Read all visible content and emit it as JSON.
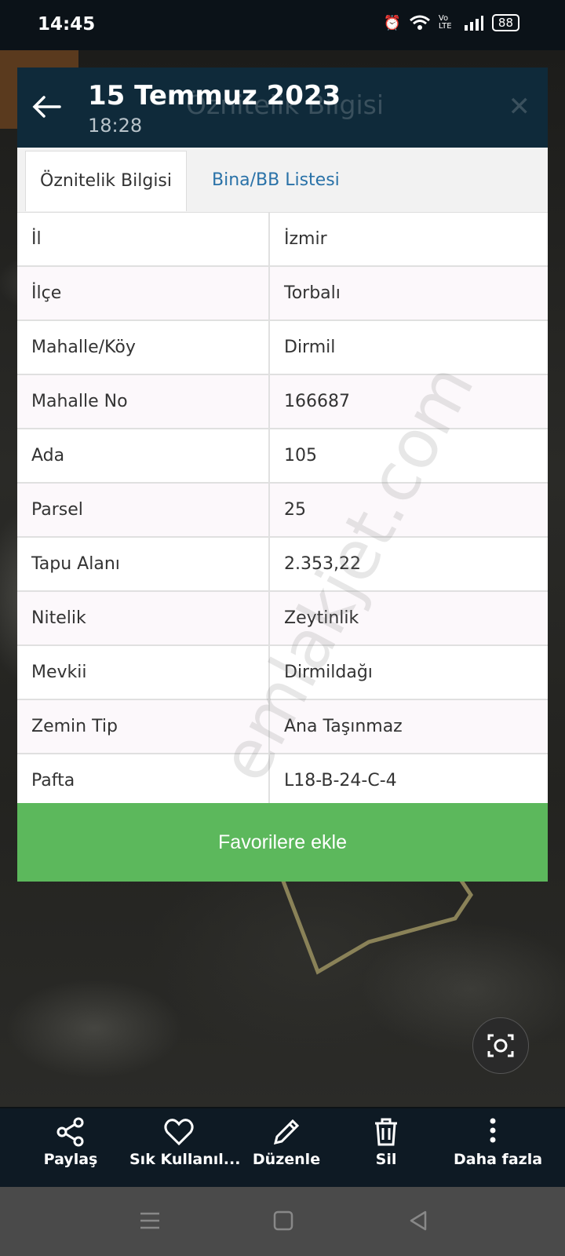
{
  "status_bar": {
    "time": "14:45",
    "network": "Vo LTE",
    "battery": "88"
  },
  "header": {
    "title": "15 Temmuz 2023",
    "subtitle": "18:28",
    "ghost_title": "Öznitelik Bilgisi",
    "ghost_close": "✕"
  },
  "tabs": [
    {
      "label": "Öznitelik Bilgisi",
      "active": true
    },
    {
      "label": "Bina/BB Listesi",
      "active": false
    }
  ],
  "attributes": [
    {
      "key": "İl",
      "value": "İzmir"
    },
    {
      "key": "İlçe",
      "value": "Torbalı"
    },
    {
      "key": "Mahalle/Köy",
      "value": "Dirmil"
    },
    {
      "key": "Mahalle No",
      "value": "166687"
    },
    {
      "key": "Ada",
      "value": "105"
    },
    {
      "key": "Parsel",
      "value": "25"
    },
    {
      "key": "Tapu Alanı",
      "value": "2.353,22"
    },
    {
      "key": "Nitelik",
      "value": "Zeytinlik"
    },
    {
      "key": "Mevkii",
      "value": "Dirmildağı"
    },
    {
      "key": "Zemin Tip",
      "value": "Ana Taşınmaz"
    },
    {
      "key": "Pafta",
      "value": "L18-B-24-C-4"
    }
  ],
  "favorite_button": "Favorilere ekle",
  "toolbar": {
    "share": "Paylaş",
    "frequent": "Sık Kullanıl...",
    "edit": "Düzenle",
    "delete": "Sil",
    "more": "Daha fazla"
  },
  "watermark": "emlakjet.com",
  "colors": {
    "header_bg": "#0f2a3a",
    "tab_link": "#2a72a8",
    "favorite_green": "#5cb85c",
    "parcel_outline": "#8a8258"
  }
}
